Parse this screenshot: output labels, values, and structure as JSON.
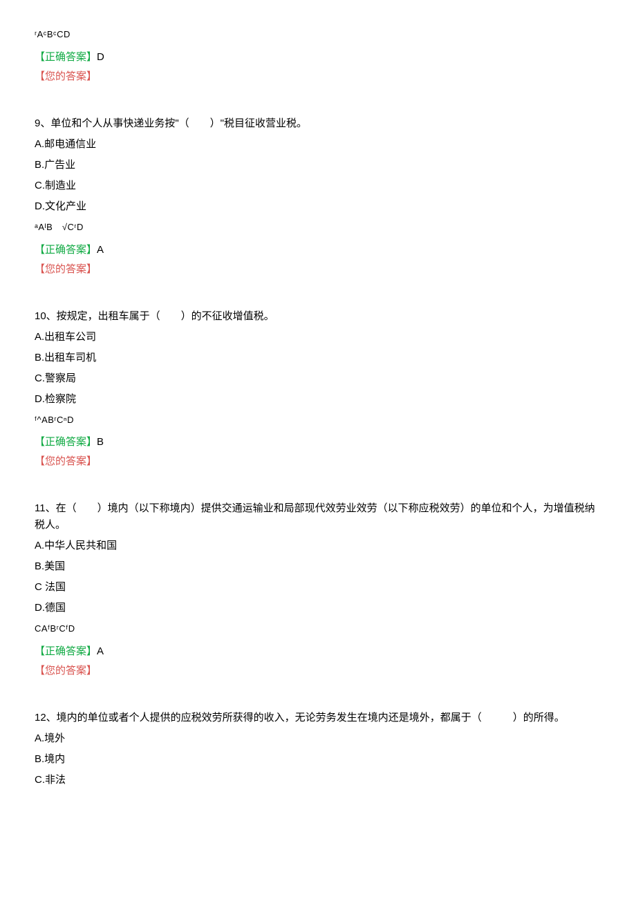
{
  "q8": {
    "optline": "ʳAᶜBᶜCD",
    "correct_label": "【正确答案】",
    "correct_value": "D",
    "your_label": "【您的答案】"
  },
  "q9": {
    "text": "9、单位和个人从事快递业务按\"（　　）\"税目征收营业税。",
    "a": "A.邮电通信业",
    "b": "B.广告业",
    "c": "C.制造业",
    "d": "D.文化产业",
    "optline": "ᵃAᴵB　√CʳD",
    "correct_label": "【正确答案】",
    "correct_value": "A",
    "your_label": "【您的答案】"
  },
  "q10": {
    "text": "10、按规定，出租车属于（　　）的不征收增值税。",
    "a": "A.出租车公司",
    "b": "B.出租车司机",
    "c": "C.警察局",
    "d": "D.检察院",
    "optline": "ᶠ^ABʳCⁿD",
    "correct_label": "【正确答案】",
    "correct_value": "B",
    "your_label": "【您的答案】"
  },
  "q11": {
    "text": "11、在（　　）境内（以下称境内）提供交通运输业和局部现代效劳业效劳（以下称应税效劳）的单位和个人，为增值税纳税人。",
    "a": "A.中华人民共和国",
    "b": "B.美国",
    "c": "C 法国",
    "d": "D.德国",
    "optline": "CAᶠBʳCᶠD",
    "correct_label": "【正确答案】",
    "correct_value": "A",
    "your_label": "【您的答案】"
  },
  "q12": {
    "text": "12、境内的单位或者个人提供的应税效劳所获得的收入，无论劳务发生在境内还是境外，都属于（　　　）的所得。",
    "a": "A.境外",
    "b": "B.境内",
    "c": "C.非法"
  }
}
